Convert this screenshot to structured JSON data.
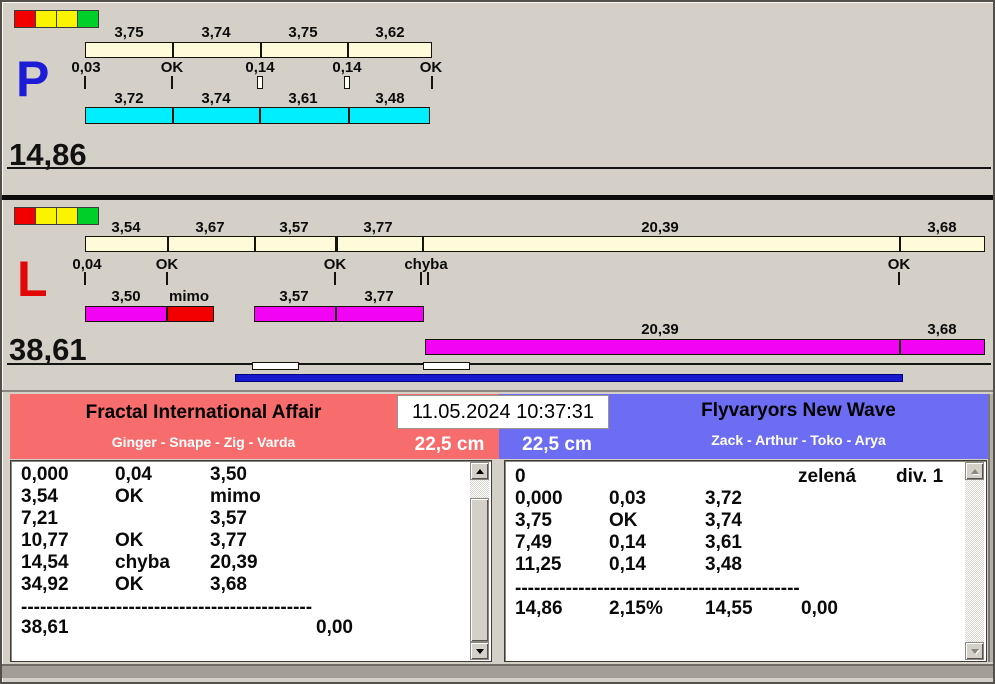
{
  "colors": {
    "background": "#d4d0c8",
    "cream_bar": "#fdfbd9",
    "cyan_bar": "#00eeff",
    "magenta_bar": "#f303f3",
    "error_segment_red": "#f20000",
    "progress_blue": "#1818cc",
    "p_letter_blue": "#1c1cd6",
    "l_letter_red": "#e30808",
    "team_left_bg": "#f76c6c",
    "team_right_bg": "#6d6df3",
    "status_square_red": "#f20000",
    "status_square_yellow": "#fbf400",
    "status_square_green": "#00cf2a"
  },
  "panel_p": {
    "side_label": "P",
    "total": "14,86",
    "status_squares": [
      "red",
      "yellow",
      "yellow",
      "green"
    ],
    "top_labels": [
      "3,75",
      "3,74",
      "3,75",
      "3,62"
    ],
    "mid_labels": [
      "0,03",
      "OK",
      "0,14",
      "0,14",
      "OK"
    ],
    "bottom_labels": [
      "3,72",
      "3,74",
      "3,61",
      "3,48"
    ]
  },
  "panel_l": {
    "side_label": "L",
    "total": "38,61",
    "status_squares": [
      "red",
      "yellow",
      "yellow",
      "green"
    ],
    "top_labels": [
      "3,54",
      "3,67",
      "3,57",
      "3,77",
      "20,39",
      "3,68"
    ],
    "mid_labels": [
      "0,04",
      "OK",
      "OK",
      "chyba",
      "OK"
    ],
    "magenta_labels_row1": [
      "3,50",
      "mimo",
      "3,57",
      "3,77"
    ],
    "magenta_labels_row2": [
      "20,39",
      "3,68"
    ]
  },
  "scoreboard": {
    "datetime": "11.05.2024 10:37:31",
    "left": {
      "team": "Fractal International Affair",
      "players": "Ginger - Snape - Zig - Varda",
      "distance": "22,5 cm"
    },
    "right": {
      "team": "Flyvaryors New Wave",
      "players": "Zack - Arthur - Toko - Arya",
      "distance": "22,5 cm"
    }
  },
  "left_list": {
    "rows": [
      [
        "0,000",
        "0,04",
        "3,50"
      ],
      [
        "3,54",
        "OK",
        "mimo"
      ],
      [
        "7,21",
        "",
        "3,57"
      ],
      [
        "10,77",
        "OK",
        "3,77"
      ],
      [
        "14,54",
        "chyba",
        "20,39"
      ],
      [
        "34,92",
        "OK",
        "3,68"
      ]
    ],
    "separator": "----------------------------------------------",
    "total_row": [
      "38,61",
      "0,00"
    ]
  },
  "right_list": {
    "header_row": [
      "0",
      "zelená",
      "div. 1"
    ],
    "rows": [
      [
        "0,000",
        "0,03",
        "3,72"
      ],
      [
        "3,75",
        "OK",
        "3,74"
      ],
      [
        "7,49",
        "0,14",
        "3,61"
      ],
      [
        "11,25",
        "0,14",
        "3,48"
      ]
    ],
    "separator": "---------------------------------------------",
    "total_row": [
      "14,86",
      "2,15%",
      "14,55",
      "0,00"
    ]
  }
}
